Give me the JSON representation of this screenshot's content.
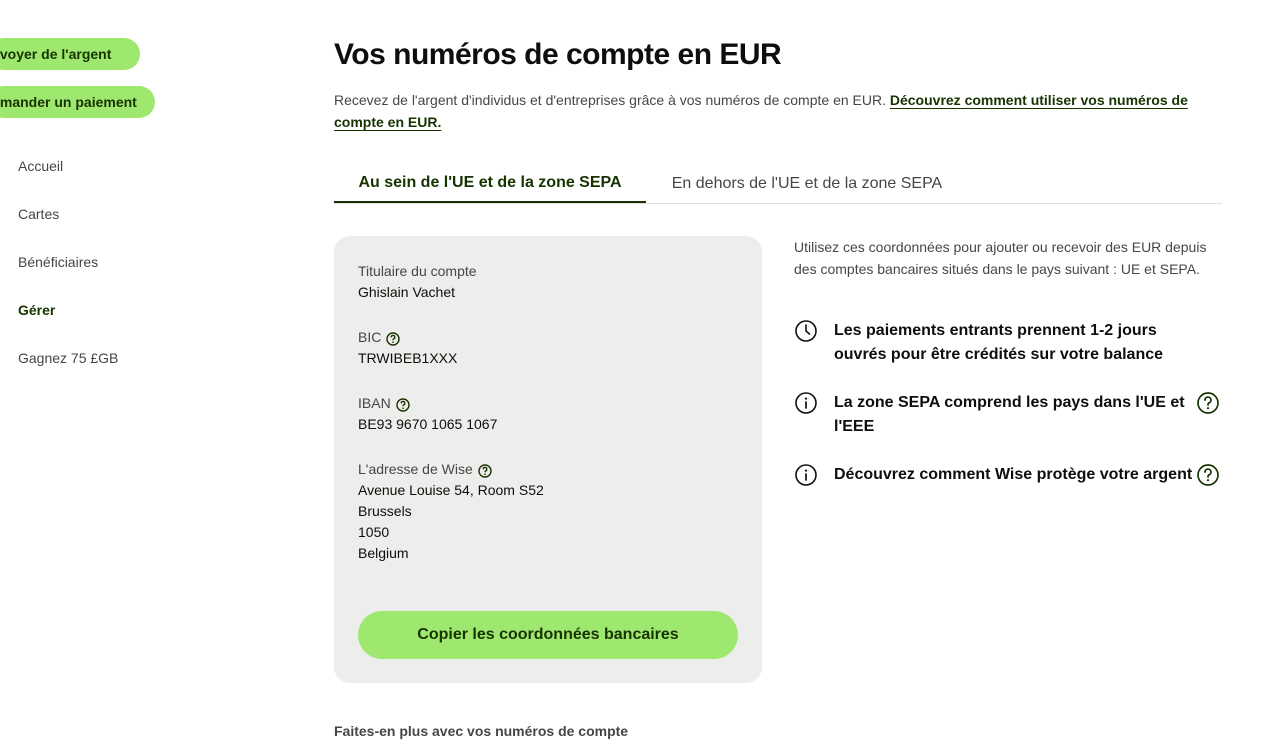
{
  "sidebar": {
    "send_label": "Envoyer de l'argent",
    "request_label": "Demander un paiement",
    "items": [
      {
        "label": "Accueil",
        "icon": "home-icon"
      },
      {
        "label": "Cartes",
        "icon": "card-icon"
      },
      {
        "label": "Bénéficiaires",
        "icon": "recipients-icon"
      },
      {
        "label": "Gérer",
        "icon": "manage-icon",
        "active": true
      },
      {
        "label": "Gagnez 75 £GB",
        "icon": "gift-icon"
      }
    ]
  },
  "main": {
    "title": "Vos numéros de compte en EUR",
    "intro": "Recevez de l'argent d'individus et d'entreprises grâce à vos numéros de compte en EUR.",
    "intro_link": "Découvrez comment utiliser vos numéros de compte en EUR.",
    "tabs": [
      {
        "label": "Au sein de l'UE et de la zone SEPA",
        "active": true
      },
      {
        "label": "En dehors de l'UE et de la zone SEPA",
        "active": false
      }
    ],
    "details": {
      "holder_label": "Titulaire du compte",
      "holder_value": "Ghislain Vachet",
      "bic_label": "BIC",
      "bic_value": "TRWIBEB1XXX",
      "iban_label": "IBAN",
      "iban_value": "BE93 9670 1065 1067",
      "address_label": "L'adresse de Wise",
      "address_lines": [
        "Avenue Louise 54, Room S52",
        "Brussels",
        "1050",
        "Belgium"
      ],
      "copy_button": "Copier les coordonnées bancaires"
    },
    "info": {
      "description": "Utilisez ces coordonnées pour ajouter ou recevoir des EUR depuis des comptes bancaires situés dans le pays suivant : UE et SEPA.",
      "items": [
        {
          "text": "Les paiements entrants prennent 1-2 jours ouvrés pour être crédités sur votre balance",
          "icon": "clock-icon"
        },
        {
          "text": "La zone SEPA comprend les pays dans l'UE et l'EEE",
          "icon": "info-icon"
        },
        {
          "text": "Découvrez comment Wise protège votre argent",
          "icon": "info-icon"
        }
      ]
    },
    "more_title": "Faites-en plus avec vos numéros de compte"
  },
  "colors": {
    "accent": "#9fe870",
    "accent_text": "#163300",
    "card_bg": "#ededeb",
    "text_secondary": "#454745"
  }
}
